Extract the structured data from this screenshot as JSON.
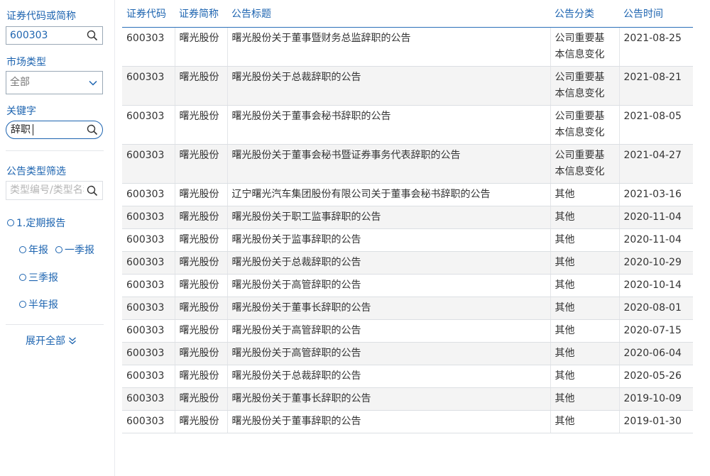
{
  "sidebar": {
    "code_label": "证券代码或简称",
    "code_value": "600303",
    "market_label": "市场类型",
    "market_value": "全部",
    "keyword_label": "关键字",
    "keyword_value": "辞职",
    "type_filter_label": "公告类型筛选",
    "type_placeholder": "类型编号/类型名称",
    "radios": {
      "periodic": "1.定期报告",
      "annual": "年报",
      "q1": "一季报",
      "q3": "三季报",
      "half": "半年报"
    },
    "expand_all": "展开全部"
  },
  "table": {
    "headers": {
      "code": "证券代码",
      "name": "证券简称",
      "title": "公告标题",
      "category": "公告分类",
      "time": "公告时间"
    },
    "rows": [
      {
        "code": "600303",
        "name": "曙光股份",
        "title": "曙光股份关于董事暨财务总监辞职的公告",
        "cat1": "公司重要基",
        "cat2": "本信息变化",
        "date": "2021-08-25"
      },
      {
        "code": "600303",
        "name": "曙光股份",
        "title": "曙光股份关于总裁辞职的公告",
        "cat1": "公司重要基",
        "cat2": "本信息变化",
        "date": "2021-08-21"
      },
      {
        "code": "600303",
        "name": "曙光股份",
        "title": "曙光股份关于董事会秘书辞职的公告",
        "cat1": "公司重要基",
        "cat2": "本信息变化",
        "date": "2021-08-05"
      },
      {
        "code": "600303",
        "name": "曙光股份",
        "title": "曙光股份关于董事会秘书暨证券事务代表辞职的公告",
        "cat1": "公司重要基",
        "cat2": "本信息变化",
        "date": "2021-04-27"
      },
      {
        "code": "600303",
        "name": "曙光股份",
        "title": "辽宁曙光汽车集团股份有限公司关于董事会秘书辞职的公告",
        "cat1": "其他",
        "cat2": "",
        "date": "2021-03-16"
      },
      {
        "code": "600303",
        "name": "曙光股份",
        "title": "曙光股份关于职工监事辞职的公告",
        "cat1": "其他",
        "cat2": "",
        "date": "2020-11-04"
      },
      {
        "code": "600303",
        "name": "曙光股份",
        "title": "曙光股份关于监事辞职的公告",
        "cat1": "其他",
        "cat2": "",
        "date": "2020-11-04"
      },
      {
        "code": "600303",
        "name": "曙光股份",
        "title": "曙光股份关于总裁辞职的公告",
        "cat1": "其他",
        "cat2": "",
        "date": "2020-10-29"
      },
      {
        "code": "600303",
        "name": "曙光股份",
        "title": "曙光股份关于高管辞职的公告",
        "cat1": "其他",
        "cat2": "",
        "date": "2020-10-14"
      },
      {
        "code": "600303",
        "name": "曙光股份",
        "title": "曙光股份关于董事长辞职的公告",
        "cat1": "其他",
        "cat2": "",
        "date": "2020-08-01"
      },
      {
        "code": "600303",
        "name": "曙光股份",
        "title": "曙光股份关于高管辞职的公告",
        "cat1": "其他",
        "cat2": "",
        "date": "2020-07-15"
      },
      {
        "code": "600303",
        "name": "曙光股份",
        "title": "曙光股份关于高管辞职的公告",
        "cat1": "其他",
        "cat2": "",
        "date": "2020-06-04"
      },
      {
        "code": "600303",
        "name": "曙光股份",
        "title": "曙光股份关于总裁辞职的公告",
        "cat1": "其他",
        "cat2": "",
        "date": "2020-05-26"
      },
      {
        "code": "600303",
        "name": "曙光股份",
        "title": "曙光股份关于董事长辞职的公告",
        "cat1": "其他",
        "cat2": "",
        "date": "2019-10-09"
      },
      {
        "code": "600303",
        "name": "曙光股份",
        "title": "曙光股份关于董事辞职的公告",
        "cat1": "其他",
        "cat2": "",
        "date": "2019-01-30"
      }
    ]
  }
}
